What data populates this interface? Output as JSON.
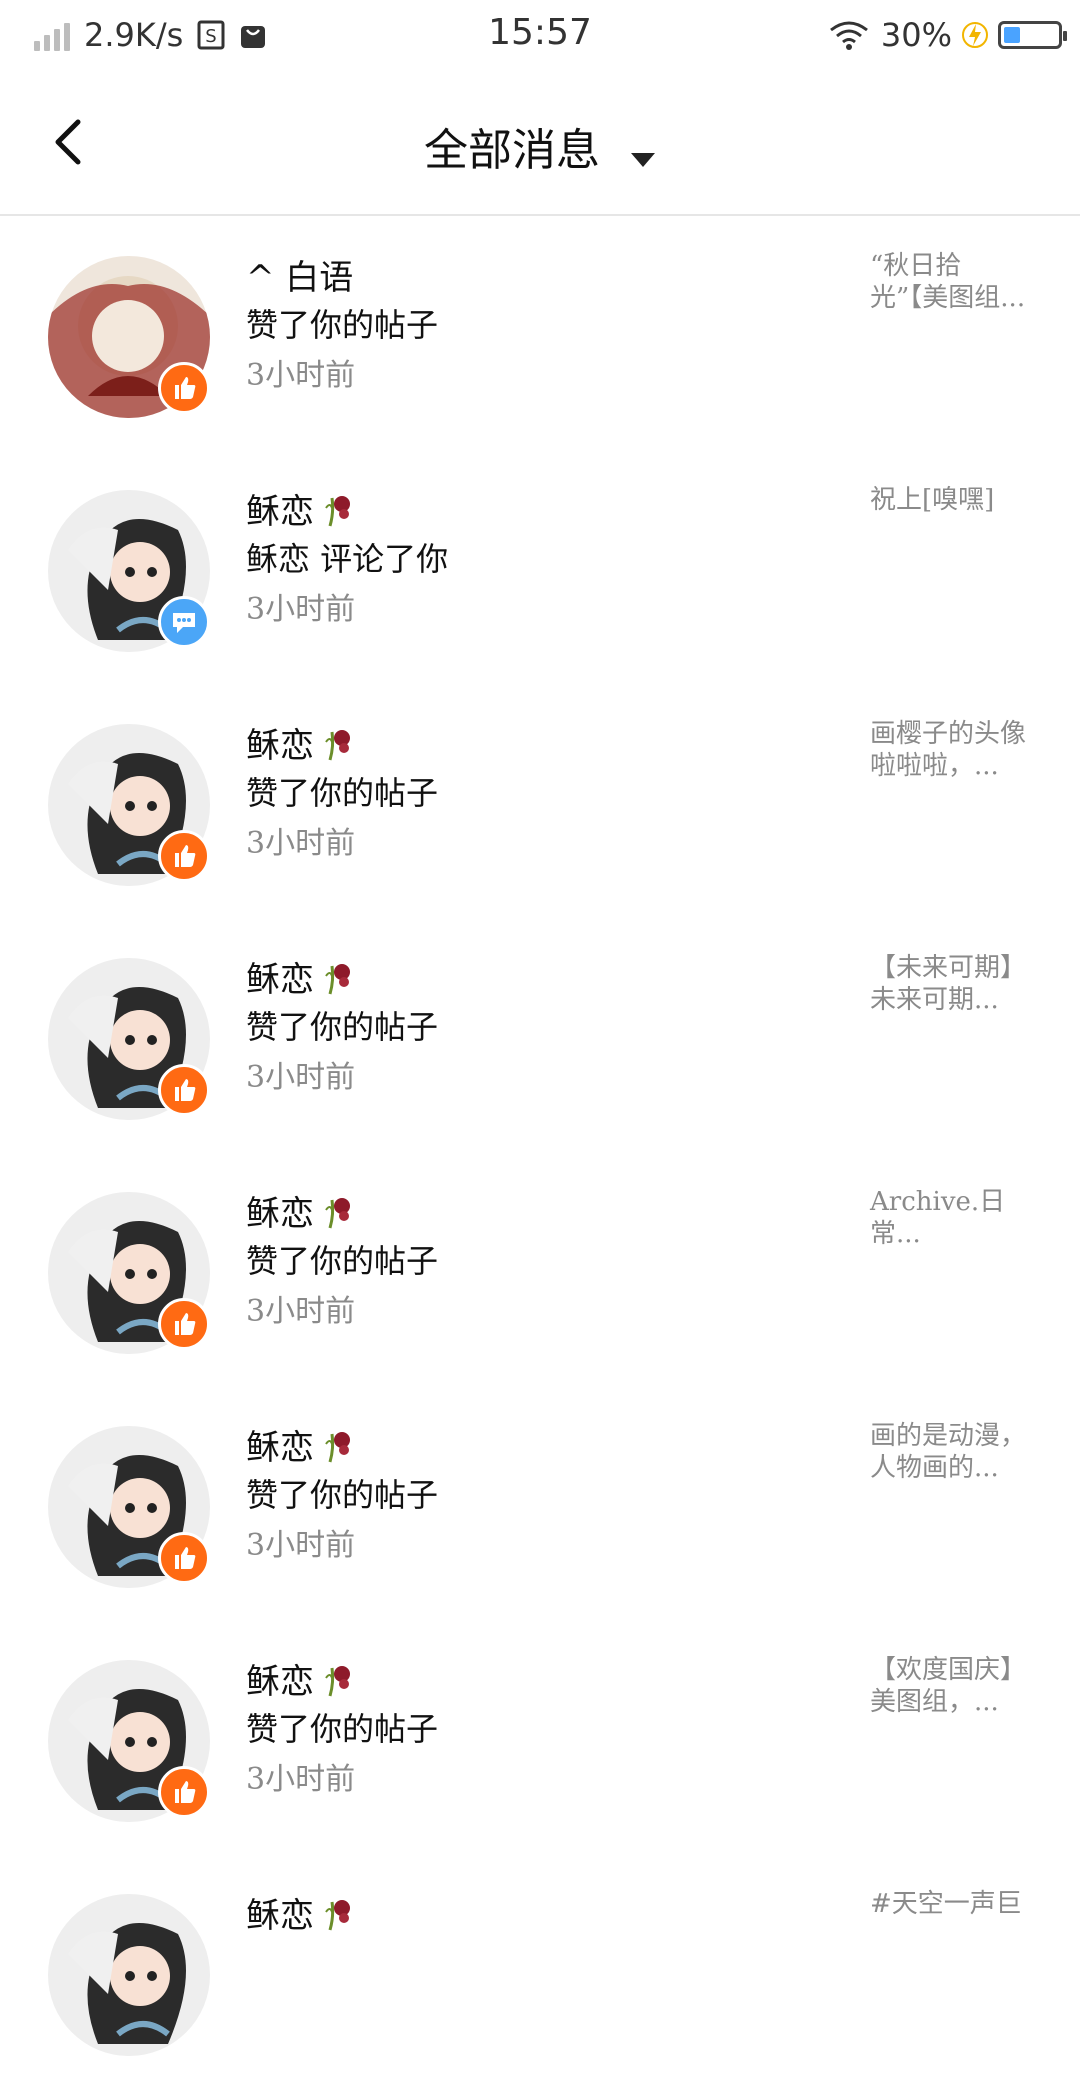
{
  "status_bar": {
    "network_speed": "2.9K/s",
    "time": "15:57",
    "battery_percent": "30%",
    "battery_level": 0.3
  },
  "header": {
    "title": "全部消息"
  },
  "messages": [
    {
      "name": "^  白语",
      "action": "赞了你的帖子",
      "time": "3小时前",
      "snippet": "“秋日拾\n光”【美图组...",
      "badge": "like"
    },
    {
      "name": "稣恋",
      "action": "稣恋 评论了你",
      "time": "3小时前",
      "snippet": "祝上[嗅嘿]",
      "badge": "comment"
    },
    {
      "name": "稣恋",
      "action": "赞了你的帖子",
      "time": "3小时前",
      "snippet": "画樱子的头像\n啦啦啦，...",
      "badge": "like"
    },
    {
      "name": "稣恋",
      "action": "赞了你的帖子",
      "time": "3小时前",
      "snippet": "【未来可期】\n未来可期...",
      "badge": "like"
    },
    {
      "name": "稣恋",
      "action": "赞了你的帖子",
      "time": "3小时前",
      "snippet": "Archive.日常...",
      "badge": "like"
    },
    {
      "name": "稣恋",
      "action": "赞了你的帖子",
      "time": "3小时前",
      "snippet": "画的是动漫，\n人物画的...",
      "badge": "like"
    },
    {
      "name": "稣恋",
      "action": "赞了你的帖子",
      "time": "3小时前",
      "snippet": "【欢度国庆】\n美图组，...",
      "badge": "like"
    },
    {
      "name": "稣恋",
      "action": "",
      "time": "",
      "snippet": "#天空一声巨",
      "badge": "none"
    }
  ],
  "colors": {
    "like_badge": "#ff6a13",
    "comment_badge": "#4ba6f7",
    "secondary_text": "#8a8a8a"
  }
}
